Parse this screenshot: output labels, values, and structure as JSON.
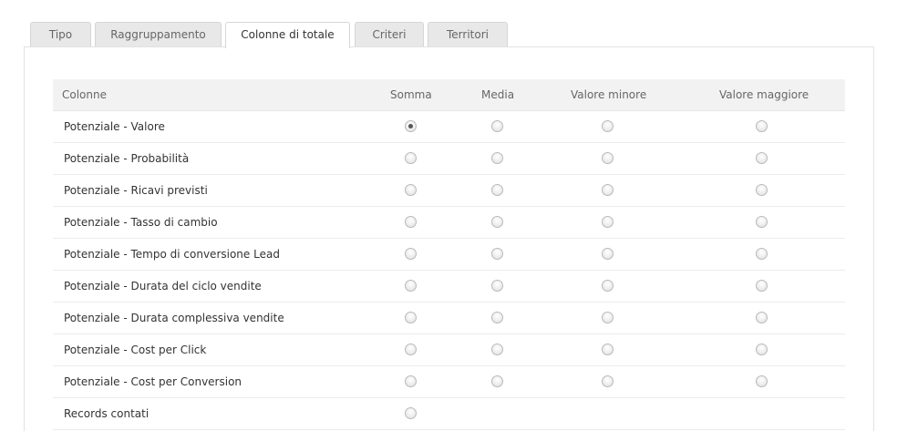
{
  "tabs": [
    {
      "label": "Tipo"
    },
    {
      "label": "Raggruppamento"
    },
    {
      "label": "Colonne di totale",
      "active": true
    },
    {
      "label": "Criteri"
    },
    {
      "label": "Territori"
    }
  ],
  "table": {
    "headers": {
      "colonne": "Colonne",
      "somma": "Somma",
      "media": "Media",
      "valore_minore": "Valore minore",
      "valore_maggiore": "Valore maggiore"
    },
    "rows": [
      {
        "label": "Potenziale - Valore",
        "somma_selected": true
      },
      {
        "label": "Potenziale - Probabilità"
      },
      {
        "label": "Potenziale - Ricavi previsti"
      },
      {
        "label": "Potenziale - Tasso di cambio"
      },
      {
        "label": "Potenziale - Tempo di conversione Lead"
      },
      {
        "label": "Potenziale - Durata del ciclo vendite"
      },
      {
        "label": "Potenziale - Durata complessiva vendite"
      },
      {
        "label": "Potenziale - Cost per Click"
      },
      {
        "label": "Potenziale - Cost per Conversion"
      },
      {
        "label": "Records contati",
        "somma_only": true
      }
    ]
  }
}
